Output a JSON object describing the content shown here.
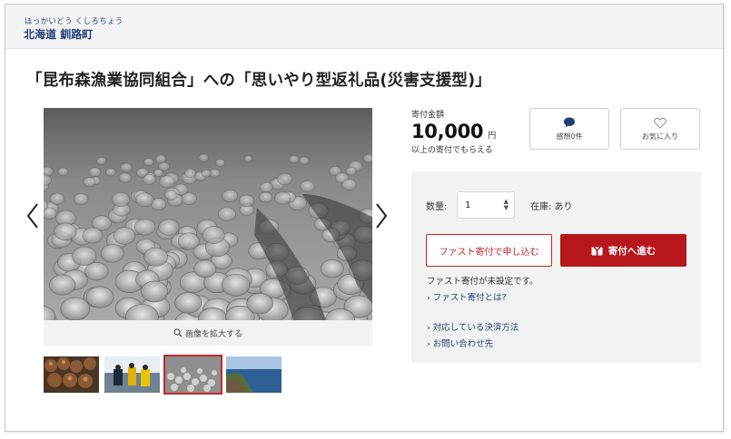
{
  "header": {
    "municipality_kana": "ほっかいどう くしろちょう",
    "municipality": "北海道 釧路町"
  },
  "product": {
    "title": "「昆布森漁業協同組合」への「思いやり型返礼品(災害支援型)」"
  },
  "gallery": {
    "zoom_label": "画像を拡大する",
    "thumbnails": [
      {
        "selected": false
      },
      {
        "selected": false
      },
      {
        "selected": true
      },
      {
        "selected": false
      }
    ]
  },
  "price": {
    "label": "寄付金額",
    "amount": "10,000",
    "unit": "円",
    "note": "以上の寄付でもらえる"
  },
  "actions": {
    "review": {
      "label": "感想0件",
      "icon": "speech-bubble-icon"
    },
    "favorite": {
      "label": "お気に入り",
      "icon": "heart-icon"
    }
  },
  "order": {
    "quantity_label": "数量:",
    "quantity_value": "1",
    "stock_text": "在庫: あり",
    "fast_button": "ファスト寄付で申し込む",
    "donate_button": "寄付へ進む",
    "fast_note": "ファスト寄付が未設定です。",
    "links": {
      "fast_about": "ファスト寄付とは?",
      "payment_methods": "対応している決済方法",
      "contact": "お問い合わせ先"
    }
  },
  "colors": {
    "accent_red": "#b8161d",
    "link_navy": "#1f3e78",
    "panel_bg": "#f2f2f2"
  }
}
